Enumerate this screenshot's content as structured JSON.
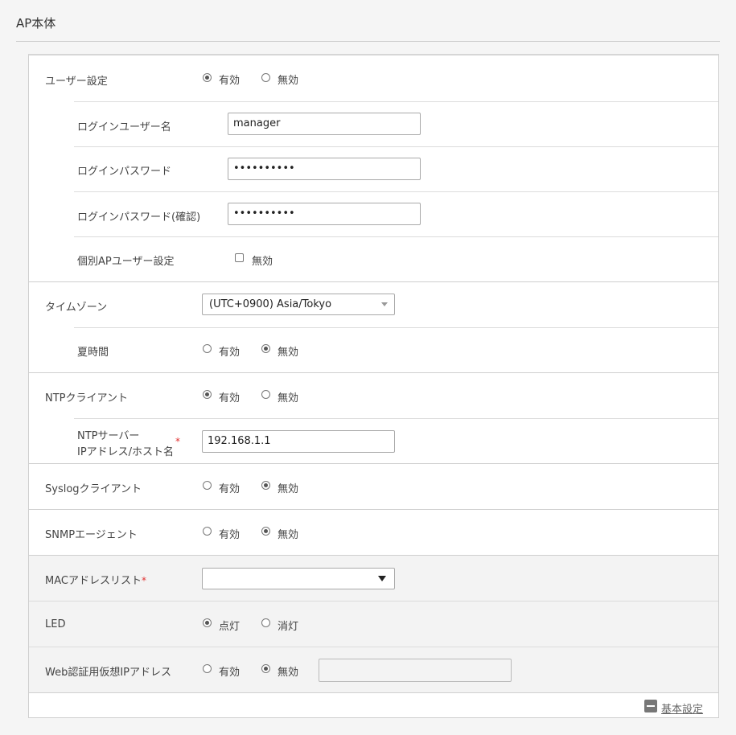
{
  "title": "AP本体",
  "user_settings": {
    "label": "ユーザー設定",
    "opt_enable": "有効",
    "opt_disable": "無効",
    "login_user_label": "ログインユーザー名",
    "login_user_value": "manager",
    "login_pass_label": "ログインパスワード",
    "login_pass_value": "••••••••••",
    "login_pass_confirm_label": "ログインパスワード(確認)",
    "login_pass_confirm_value": "••••••••••",
    "individual_label": "個別APユーザー設定",
    "individual_opt": "無効"
  },
  "timezone": {
    "label": "タイムゾーン",
    "value": "(UTC+0900) Asia/Tokyo",
    "dst_label": "夏時間",
    "opt_enable": "有効",
    "opt_disable": "無効"
  },
  "ntp": {
    "label": "NTPクライアント",
    "opt_enable": "有効",
    "opt_disable": "無効",
    "server_label_line1": "NTPサーバー",
    "server_label_line2": "IPアドレス/ホスト名",
    "required_mark": "*",
    "server_value": "192.168.1.1"
  },
  "syslog": {
    "label": "Syslogクライアント",
    "opt_enable": "有効",
    "opt_disable": "無効"
  },
  "snmp": {
    "label": "SNMPエージェント",
    "opt_enable": "有効",
    "opt_disable": "無効"
  },
  "mac": {
    "label": "MACアドレスリスト",
    "required_mark": "*",
    "value": ""
  },
  "led": {
    "label": "LED",
    "opt_on": "点灯",
    "opt_off": "消灯"
  },
  "web_auth": {
    "label": "Web認証用仮想IPアドレス",
    "opt_enable": "有効",
    "opt_disable": "無効",
    "value": ""
  },
  "footer": {
    "basic_settings_link": "基本設定",
    "icon": "minus-square-icon"
  },
  "colors": {
    "required": "#e03030",
    "border": "#a9a9a9"
  }
}
